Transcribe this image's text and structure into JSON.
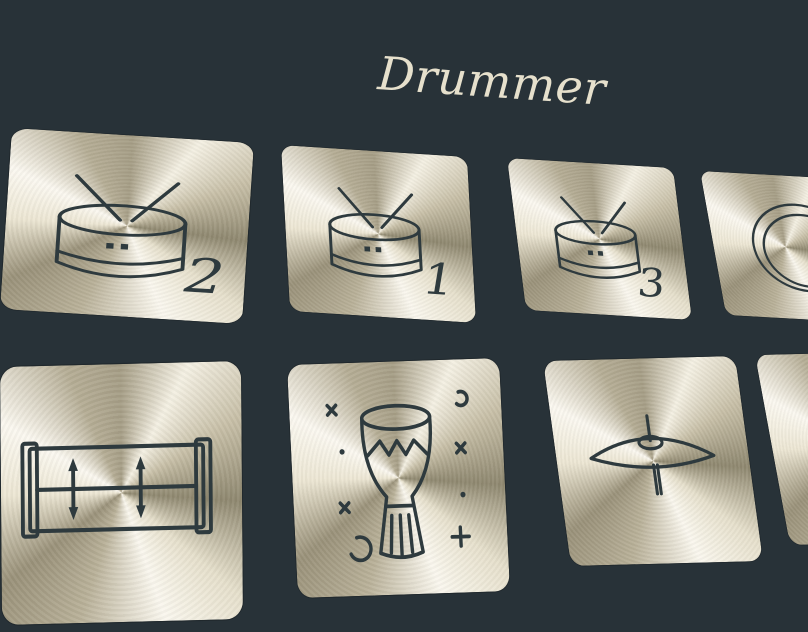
{
  "title": "Drummer",
  "colors": {
    "background": "#283238",
    "title": "#e6e0cc",
    "icon_stroke": "#2e3a3e"
  },
  "tiles": [
    {
      "icon": "snare-drum-icon",
      "number": "2"
    },
    {
      "icon": "snare-drum-icon",
      "number": "1"
    },
    {
      "icon": "snare-drum-icon",
      "number": "3"
    },
    {
      "icon": "tambourine-icon",
      "number": ""
    },
    {
      "icon": "bass-drum-icon",
      "number": ""
    },
    {
      "icon": "djembe-icon",
      "number": ""
    },
    {
      "icon": "cymbal-icon",
      "number": ""
    },
    {
      "icon": "partial-tile",
      "number": ""
    }
  ]
}
